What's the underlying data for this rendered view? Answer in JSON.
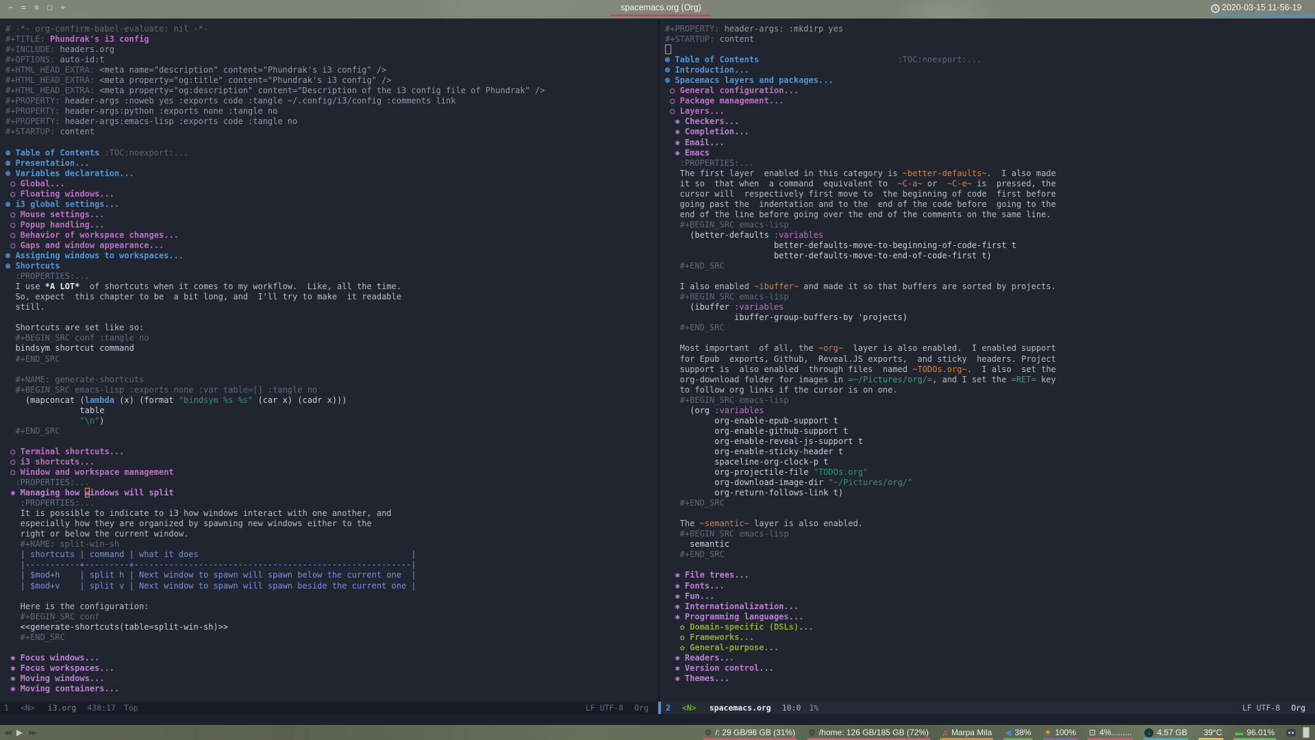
{
  "titlebar": {
    "icons": [
      "−",
      "=",
      "≡",
      "□",
      "+"
    ],
    "title": "spacemacs.org (Org)",
    "clock": "2020-03-15 11-56-19",
    "title_underline": "#df3a66",
    "clock_underline": "#2f9ade"
  },
  "panes": {
    "left": [
      [
        [
          "c",
          "# -*- org-confirm-babel-evaluate: nil -*-"
        ]
      ],
      [
        [
          "m",
          "#+TITLE: "
        ],
        [
          "t1v",
          "Phundrak's i3 config"
        ]
      ],
      [
        [
          "m",
          "#+INCLUDE: "
        ],
        [
          "mv",
          "headers.org"
        ]
      ],
      [
        [
          "m",
          "#+OPTIONS: "
        ],
        [
          "mv",
          "auto-id:t"
        ]
      ],
      [
        [
          "m",
          "#+HTML_HEAD_EXTRA: "
        ],
        [
          "mv",
          "<meta name=\"description\" content=\"Phundrak's i3 config\" />"
        ]
      ],
      [
        [
          "m",
          "#+HTML_HEAD_EXTRA: "
        ],
        [
          "mv",
          "<meta property=\"og:title\" content=\"Phundrak's i3 config\" />"
        ]
      ],
      [
        [
          "m",
          "#+HTML_HEAD_EXTRA: "
        ],
        [
          "mv",
          "<meta property=\"og:description\" content=\"Description of the i3 config file of Phundrak\" />"
        ]
      ],
      [
        [
          "m",
          "#+PROPERTY: "
        ],
        [
          "mv",
          "header-args :noweb yes :exports code :tangle ~/.config/i3/config :comments link"
        ]
      ],
      [
        [
          "m",
          "#+PROPERTY: "
        ],
        [
          "mv",
          "header-args:python :exports none :tangle no"
        ]
      ],
      [
        [
          "m",
          "#+PROPERTY: "
        ],
        [
          "mv",
          "header-args:emacs-lisp :exports code :tangle no"
        ]
      ],
      [
        [
          "m",
          "#+STARTUP: "
        ],
        [
          "mv",
          "content"
        ]
      ],
      [],
      [
        [
          "h1",
          "⊛ Table of Contents"
        ],
        [
          "tg",
          " :TOC:noexport:..."
        ]
      ],
      [
        [
          "h1",
          "⊛ Presentation..."
        ]
      ],
      [
        [
          "h1",
          "⊛ Variables declaration..."
        ]
      ],
      [
        [
          "h2",
          " ○ Global..."
        ]
      ],
      [
        [
          "h2",
          " ○ Floating windows..."
        ]
      ],
      [
        [
          "h1",
          "⊛ i3 global settings..."
        ]
      ],
      [
        [
          "h2",
          " ○ Mouse settings..."
        ]
      ],
      [
        [
          "h2",
          " ○ Popup handling..."
        ]
      ],
      [
        [
          "h2",
          " ○ Behavior of workspace changes..."
        ]
      ],
      [
        [
          "h2",
          " ○ Gaps and window appearance..."
        ]
      ],
      [
        [
          "h1",
          "⊛ Assigning windows to workspaces..."
        ]
      ],
      [
        [
          "h1",
          "⊛ Shortcuts"
        ]
      ],
      [
        [
          "pr",
          "  :PROPERTIES:..."
        ]
      ],
      [
        [
          "b",
          "  I use "
        ],
        [
          "bd",
          "*A LOT*"
        ],
        [
          "b",
          "  of shortcuts when it comes to my workflow.  Like, all the time."
        ]
      ],
      [
        [
          "b",
          "  So, expect  this chapter to be  a bit long, and  I'll try to make  it readable"
        ]
      ],
      [
        [
          "b",
          "  still."
        ]
      ],
      [],
      [
        [
          "b",
          "  Shortcuts are set like so:"
        ]
      ],
      [
        [
          "m",
          "  #+BEGIN_SRC conf :tangle no"
        ]
      ],
      [
        [
          "cd",
          "  bindsym shortcut command"
        ]
      ],
      [
        [
          "m",
          "  #+END_SRC"
        ]
      ],
      [],
      [
        [
          "m",
          "  #+NAME: generate-shortcuts"
        ]
      ],
      [
        [
          "m",
          "  #+BEGIN_SRC emacs-lisp :exports none :var table=[] :tangle no"
        ]
      ],
      [
        [
          "cd",
          "    (mapconcat ("
        ],
        [
          "kw",
          "lambda"
        ],
        [
          "cd",
          " (x) (format "
        ],
        [
          "st",
          "\"bindsym %s %s\""
        ],
        [
          "cd",
          " (car x) (cadr x)))"
        ]
      ],
      [
        [
          "cd",
          "               table"
        ]
      ],
      [
        [
          "cd",
          "               "
        ],
        [
          "st",
          "\"\\n\""
        ],
        [
          "cd",
          ")"
        ]
      ],
      [
        [
          "m",
          "  #+END_SRC"
        ]
      ],
      [],
      [
        [
          "h2",
          " ○ Terminal shortcuts..."
        ]
      ],
      [
        [
          "h2",
          " ○ i3 shortcuts..."
        ]
      ],
      [
        [
          "h2",
          " ○ Window and workspace management"
        ]
      ],
      [
        [
          "pr",
          "  :PROPERTIES:..."
        ]
      ],
      [
        [
          "h3",
          " ✱ Managing how "
        ],
        [
          "h3 cur",
          "w"
        ],
        [
          "h3",
          "indows will split"
        ]
      ],
      [
        [
          "pr",
          "   :PROPERTIES:..."
        ]
      ],
      [
        [
          "b",
          "   It is possible to indicate to i3 how windows interact with one another, and"
        ]
      ],
      [
        [
          "b",
          "   especially how they are organized by spawning new windows either to the"
        ]
      ],
      [
        [
          "b",
          "   right or below the current window."
        ]
      ],
      [
        [
          "m",
          "   #+NAME: split-win-sh"
        ]
      ],
      [
        [
          "tb",
          "   | shortcuts | command | what it does                                           |"
        ]
      ],
      [
        [
          "tb",
          "   |-----------+---------+--------------------------------------------------------|"
        ]
      ],
      [
        [
          "tb",
          "   | $mod+h    | split h | Next window to spawn will spawn below the current one  |"
        ]
      ],
      [
        [
          "tb",
          "   | $mod+v    | split v | Next window to spawn will spawn beside the current one |"
        ]
      ],
      [],
      [
        [
          "b",
          "   Here is the configuration:"
        ]
      ],
      [
        [
          "m",
          "   #+BEGIN_SRC conf"
        ]
      ],
      [
        [
          "cd",
          "   <<generate-shortcuts(table=split-win-sh)>>"
        ]
      ],
      [
        [
          "m",
          "   #+END_SRC"
        ]
      ],
      [],
      [
        [
          "h3",
          " ✱ Focus windows..."
        ]
      ],
      [
        [
          "h3",
          " ✱ Focus workspaces..."
        ]
      ],
      [
        [
          "h3",
          " ✱ Moving windows..."
        ]
      ],
      [
        [
          "h3",
          " ✱ Moving containers..."
        ]
      ]
    ],
    "right": [
      [
        [
          "m",
          "#+PROPERTY: "
        ],
        [
          "mv",
          "header-args: :mkdirp yes"
        ]
      ],
      [
        [
          "m",
          "#+STARTUP: "
        ],
        [
          "mv",
          "content"
        ]
      ],
      [
        [
          "curbox",
          ""
        ]
      ],
      [
        [
          "h1",
          "⊛ Table of Contents"
        ],
        [
          "tg",
          "                            :TOC:noexport:..."
        ]
      ],
      [
        [
          "h1",
          "⊛ Introduction..."
        ]
      ],
      [
        [
          "h1",
          "⊛ Spacemacs layers and packages..."
        ]
      ],
      [
        [
          "h2",
          " ○ General configuration..."
        ]
      ],
      [
        [
          "h2",
          " ○ Package management..."
        ]
      ],
      [
        [
          "h2",
          " ○ Layers..."
        ]
      ],
      [
        [
          "h3",
          "  ✱ Checkers..."
        ]
      ],
      [
        [
          "h3",
          "  ✱ Completion..."
        ]
      ],
      [
        [
          "h3",
          "  ✱ Email..."
        ]
      ],
      [
        [
          "h3",
          "  ✱ Emacs"
        ]
      ],
      [
        [
          "pr",
          "   :PROPERTIES:..."
        ]
      ],
      [
        [
          "b",
          "   The first layer  enabled in this category is "
        ],
        [
          "oc",
          "~better-defaults~"
        ],
        [
          "b",
          ".  I also made"
        ]
      ],
      [
        [
          "b",
          "   it so  that when  a command  equivalent to  "
        ],
        [
          "oc",
          "~C-a~"
        ],
        [
          "b",
          " or  "
        ],
        [
          "oc",
          "~C-e~"
        ],
        [
          "b",
          " is  pressed, the"
        ]
      ],
      [
        [
          "b",
          "   cursor will  respectively first move to  the beginning of code  first before"
        ]
      ],
      [
        [
          "b",
          "   going past the  indentation and to the  end of the code before  going to the"
        ]
      ],
      [
        [
          "b",
          "   end of the line before going over the end of the comments on the same line."
        ]
      ],
      [
        [
          "m",
          "   #+BEGIN_SRC emacs-lisp"
        ]
      ],
      [
        [
          "cd",
          "     (better-defaults "
        ],
        [
          "lk",
          ":variables"
        ]
      ],
      [
        [
          "cd",
          "                      better-defaults-move-to-beginning-of-code-first t"
        ]
      ],
      [
        [
          "cd",
          "                      better-defaults-move-to-end-of-code-first t)"
        ]
      ],
      [
        [
          "m",
          "   #+END_SRC"
        ]
      ],
      [],
      [
        [
          "b",
          "   I also enabled "
        ],
        [
          "oc",
          "~ibuffer~"
        ],
        [
          "b",
          " and made it so that buffers are sorted by projects."
        ]
      ],
      [
        [
          "m",
          "   #+BEGIN_SRC emacs-lisp"
        ]
      ],
      [
        [
          "cd",
          "     (ibuffer "
        ],
        [
          "lk",
          ":variables"
        ]
      ],
      [
        [
          "cd",
          "              ibuffer-group-buffers-by 'projects)"
        ]
      ],
      [
        [
          "m",
          "   #+END_SRC"
        ]
      ],
      [],
      [
        [
          "b",
          "   Most important  of all, the "
        ],
        [
          "oc",
          "~org~"
        ],
        [
          "b",
          "  layer is also enabled.  I enabled support"
        ]
      ],
      [
        [
          "b",
          "   for Epub  exports, Github,  Reveal.JS exports,  and sticky  headers. Project"
        ]
      ],
      [
        [
          "b",
          "   support is  also enabled  through files  named "
        ],
        [
          "oc",
          "~TODOs.org~"
        ],
        [
          "b",
          ".  I also  set the"
        ]
      ],
      [
        [
          "b",
          "   org-download folder for images in "
        ],
        [
          "vb",
          "=~/Pictures/org/="
        ],
        [
          "b",
          ", and I set the "
        ],
        [
          "vb",
          "=RET="
        ],
        [
          "b",
          " key"
        ]
      ],
      [
        [
          "b",
          "   to follow org links if the cursor is on one."
        ]
      ],
      [
        [
          "m",
          "   #+BEGIN_SRC emacs-lisp"
        ]
      ],
      [
        [
          "cd",
          "     (org "
        ],
        [
          "lk",
          ":variables"
        ]
      ],
      [
        [
          "cd",
          "          org-enable-epub-support t"
        ]
      ],
      [
        [
          "cd",
          "          org-enable-github-support t"
        ]
      ],
      [
        [
          "cd",
          "          org-enable-reveal-js-support t"
        ]
      ],
      [
        [
          "cd",
          "          org-enable-sticky-header t"
        ]
      ],
      [
        [
          "cd",
          "          spaceline-org-clock-p t"
        ]
      ],
      [
        [
          "cd",
          "          org-projectile-file "
        ],
        [
          "st",
          "\"TODOs.org\""
        ]
      ],
      [
        [
          "cd",
          "          org-download-image-dir "
        ],
        [
          "st",
          "\"~/Pictures/org/\""
        ]
      ],
      [
        [
          "cd",
          "          org-return-follows-link t)"
        ]
      ],
      [
        [
          "m",
          "   #+END_SRC"
        ]
      ],
      [],
      [
        [
          "b",
          "   The "
        ],
        [
          "oc",
          "~semantic~"
        ],
        [
          "b",
          " layer is also enabled."
        ]
      ],
      [
        [
          "m",
          "   #+BEGIN_SRC emacs-lisp"
        ]
      ],
      [
        [
          "cd",
          "     semantic"
        ]
      ],
      [
        [
          "m",
          "   #+END_SRC"
        ]
      ],
      [],
      [
        [
          "h3",
          "  ✱ File trees..."
        ]
      ],
      [
        [
          "h3",
          "  ✱ Fonts..."
        ]
      ],
      [
        [
          "h3",
          "  ✱ Fun..."
        ]
      ],
      [
        [
          "h3",
          "  ✱ Internationalization..."
        ]
      ],
      [
        [
          "h3",
          "  ✱ Programming languages..."
        ]
      ],
      [
        [
          "h4",
          "   ✿ Domain-specific (DSLs)..."
        ]
      ],
      [
        [
          "h4",
          "   ✿ Frameworks..."
        ]
      ],
      [
        [
          "h4",
          "   ✿ General-purpose..."
        ]
      ],
      [
        [
          "h3",
          "  ✱ Readers..."
        ]
      ],
      [
        [
          "h3",
          "  ✱ Version control..."
        ]
      ],
      [
        [
          "h3",
          "  ✱ Themes..."
        ]
      ]
    ]
  },
  "modeline_left": {
    "win": "1",
    "state": "<N>",
    "buffer": "i3.org",
    "pos": "438:17",
    "pct": "Top",
    "eol_enc": "LF UTF-8",
    "mode": "Org"
  },
  "modeline_right": {
    "win": "2",
    "state": "<N>",
    "buffer": "spacemacs.org",
    "pos": "10:0",
    "pct": "1%",
    "eol_enc": "LF UTF-8",
    "mode": "Org"
  },
  "bottombar": {
    "media": [
      {
        "name": "previous-track-button",
        "glyph": "◀◀",
        "cls": ""
      },
      {
        "name": "play-button",
        "glyph": "▶",
        "cls": "play"
      },
      {
        "name": "next-track-button",
        "glyph": "▶▶",
        "cls": ""
      }
    ],
    "blocks": [
      {
        "name": "disk-root-block",
        "icon": "gear",
        "icon_color": "#2c323c",
        "label": "/: 29 GB/98 GB (31%)",
        "underline": "#e34f6f"
      },
      {
        "name": "disk-home-block",
        "icon": "gear",
        "icon_color": "#2c323c",
        "label": "/home: 126 GB/185 GB (72%)",
        "underline": "#e34f6f"
      },
      {
        "name": "music-block",
        "icon": "music",
        "icon_color": "#e08a2e",
        "label": "Marpa Mila",
        "underline": "#e08a2e"
      },
      {
        "name": "volume-block",
        "icon": "volume",
        "icon_color": "#4a86d8",
        "label": "38%",
        "underline": "#55b054"
      },
      {
        "name": "brightness-block",
        "icon": "brightness",
        "icon_color": "#e8c227",
        "label": "100%",
        "underline": "#9b59b6"
      },
      {
        "name": "cpu-block",
        "icon": "screen",
        "icon_color": "#d5dae2",
        "label": "4%.........",
        "underline": "#e34f6f"
      },
      {
        "name": "network-download-block",
        "icon": "download",
        "icon_color": "#3fc6dd",
        "label": "4.57 GB",
        "underline": "#2ab5c9"
      },
      {
        "name": "temperature-block",
        "icon": "thermometer",
        "icon_color": "#bcd3e6",
        "label": "39°C",
        "underline": "#e5c33f"
      },
      {
        "name": "battery-block",
        "icon": "battery",
        "icon_color": "#54c14b",
        "label": "96.01%",
        "underline": "#55c24e"
      }
    ]
  }
}
